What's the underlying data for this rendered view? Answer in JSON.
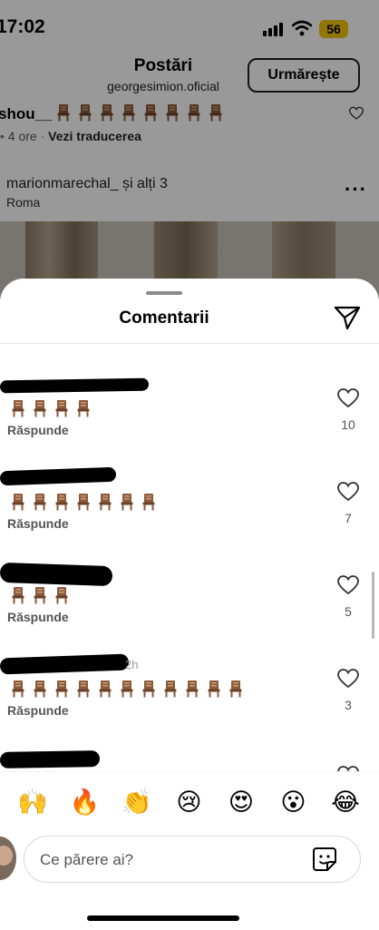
{
  "status_bar": {
    "time": "17:02",
    "battery": "56"
  },
  "post_header": {
    "title": "Postări",
    "username": "georgesimion.oficial",
    "follow_label": "Urmărește"
  },
  "background_comment": {
    "username": "shou__",
    "meta_time": "4 ore",
    "translate_label": "Vezi traducerea"
  },
  "location_row": {
    "users": "marionmarechal_ și alți 3",
    "location": "Roma"
  },
  "sheet": {
    "title": "Comentarii"
  },
  "comments": [
    {
      "chairs": 4,
      "reply_label": "Răspunde",
      "likes": "10"
    },
    {
      "chairs": 7,
      "reply_label": "Răspunde",
      "likes": "7"
    },
    {
      "chairs": 3,
      "reply_label": "Răspunde",
      "likes": "5"
    },
    {
      "chairs": 11,
      "reply_label": "Răspunde",
      "likes": "3",
      "timestamp": "2h"
    }
  ],
  "emojis": [
    {
      "icon": "raising-hands-icon",
      "char": "🙌"
    },
    {
      "icon": "fire-icon",
      "char": "🔥"
    },
    {
      "icon": "clapping-hands-icon",
      "char": "👏"
    },
    {
      "icon": "crying-face-icon",
      "char": "😢"
    },
    {
      "icon": "heart-eyes-icon",
      "char": "😍"
    },
    {
      "icon": "surprised-face-icon",
      "char": "😮"
    },
    {
      "icon": "tears-of-joy-icon",
      "char": "😂"
    }
  ],
  "input": {
    "placeholder": "Ce părere ai?"
  },
  "colors": {
    "accent": "#f2c50a",
    "chair": "#8b5a3c",
    "secondary_text": "#555555"
  }
}
